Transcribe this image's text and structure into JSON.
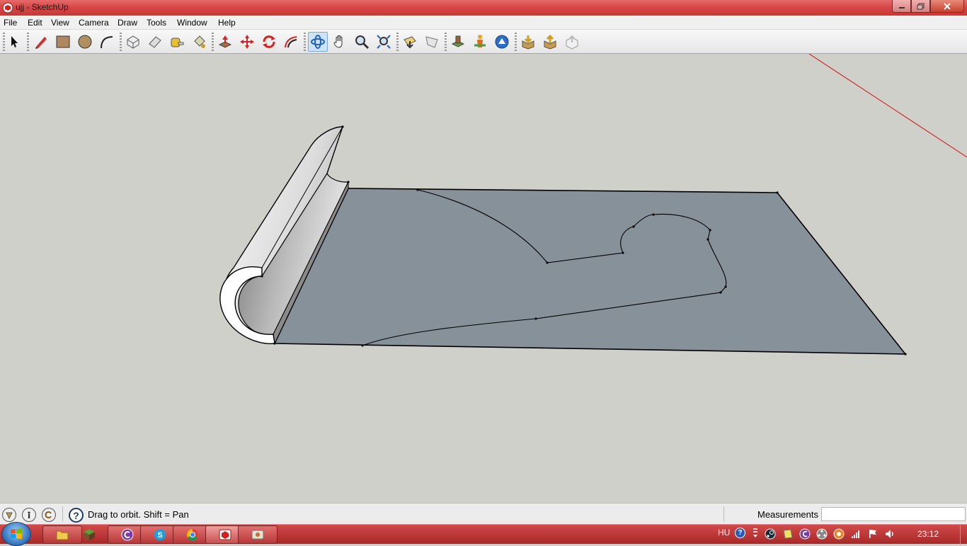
{
  "window": {
    "title": "ujj - SketchUp"
  },
  "menu": [
    "File",
    "Edit",
    "View",
    "Camera",
    "Draw",
    "Tools",
    "Window",
    "Help"
  ],
  "status": {
    "hint": "Drag to orbit.  Shift = Pan",
    "measurements_label": "Measurements",
    "measurements_value": ""
  },
  "taskbar": {
    "language": "HU",
    "clock": "23:12"
  },
  "colors": {
    "titlebar": "#d84848",
    "face": "#87919a",
    "background": "#d0d0ca",
    "axis_red": "#d01010"
  }
}
